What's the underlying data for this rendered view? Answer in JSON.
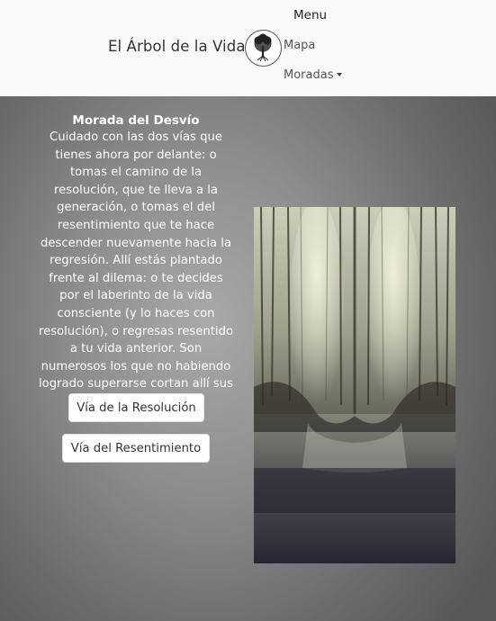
{
  "navbar": {
    "brand": "El Árbol de la Vida",
    "menu_title": "Menu",
    "links": [
      {
        "label": "Mapa"
      },
      {
        "label": "Moradas",
        "dropdown": true
      }
    ],
    "logo_icon": "tree-of-life-icon"
  },
  "main": {
    "title": "Morada del Desvío",
    "body": "Cuidado con las dos vías que tienes ahora por delante: o tomas el camino de la resolución, que te lleva a la generación, o tomas el del resentimiento que te hace descender nuevamente hacia la regresión. Allí estás plantado frente al dilema: o te decides por el laberinto de la vida consciente (y lo haces con resolución), o regresas resentido a tu vida anterior. Son numerosos los que no habiendo logrado superarse cortan allí sus posibilidades.",
    "buttons": [
      {
        "label": "Vía de la Resolución"
      },
      {
        "label": "Vía del Resentimiento"
      }
    ]
  },
  "colors": {
    "navbar_bg": "#f8f9fa",
    "page_bg_center": "#a9a9a9",
    "page_bg_edge": "#575757"
  }
}
